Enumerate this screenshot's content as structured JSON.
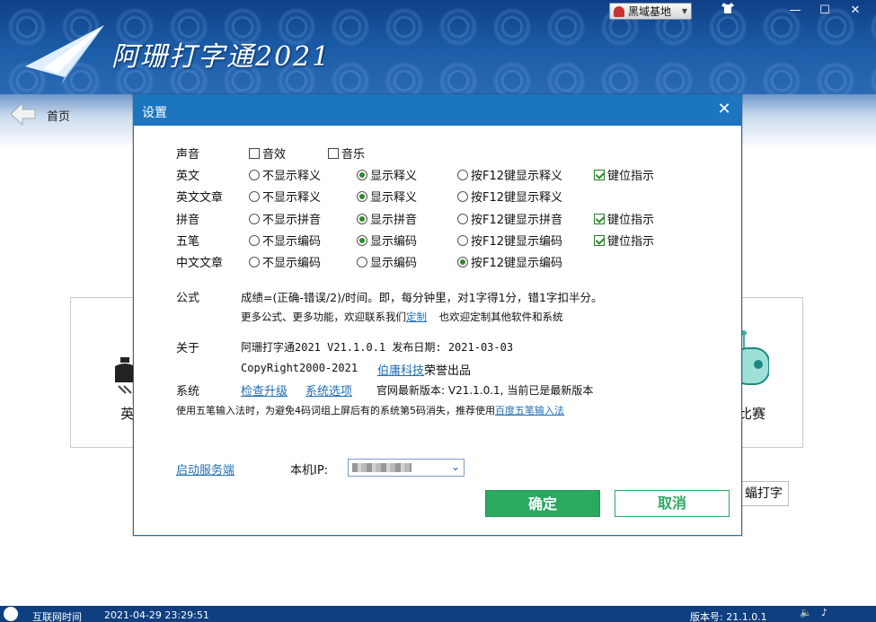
{
  "app": {
    "title": "阿珊打字通2021",
    "user_menu": "黑域基地",
    "home": "首页"
  },
  "background": {
    "tile_left_label": "英",
    "tile_right_label": "比赛",
    "type_button": "蝠打字"
  },
  "statusbar": {
    "net_time_label": "互联网时间",
    "net_time_value": "2021-04-29 23:29:51",
    "version_label": "版本号: 21.1.0.1"
  },
  "dialog": {
    "title": "设置",
    "close": "✕",
    "sound": {
      "label": "声音",
      "options": [
        {
          "label": "音效",
          "checked": false
        },
        {
          "label": "音乐",
          "checked": false
        }
      ]
    },
    "english": {
      "label": "英文",
      "options": [
        {
          "label": "不显示释义",
          "checked": false
        },
        {
          "label": "显示释义",
          "checked": true
        },
        {
          "label": "按F12键显示释义",
          "checked": false
        }
      ],
      "keyhint": {
        "label": "键位指示",
        "checked": true
      }
    },
    "english_article": {
      "label": "英文文章",
      "options": [
        {
          "label": "不显示释义",
          "checked": false
        },
        {
          "label": "显示释义",
          "checked": true
        },
        {
          "label": "按F12键显示释义",
          "checked": false
        }
      ]
    },
    "pinyin": {
      "label": "拼音",
      "options": [
        {
          "label": "不显示拼音",
          "checked": false
        },
        {
          "label": "显示拼音",
          "checked": true
        },
        {
          "label": "按F12键显示拼音",
          "checked": false
        }
      ],
      "keyhint": {
        "label": "键位指示",
        "checked": true
      }
    },
    "wubi": {
      "label": "五笔",
      "options": [
        {
          "label": "不显示编码",
          "checked": false
        },
        {
          "label": "显示编码",
          "checked": true
        },
        {
          "label": "按F12键显示编码",
          "checked": false
        }
      ],
      "keyhint": {
        "label": "键位指示",
        "checked": true
      }
    },
    "chinese_article": {
      "label": "中文文章",
      "options": [
        {
          "label": "不显示编码",
          "checked": false
        },
        {
          "label": "显示编码",
          "checked": false
        },
        {
          "label": "按F12键显示编码",
          "checked": true
        }
      ]
    },
    "formula": {
      "label": "公式",
      "text": "成绩=(正确-错误/2)/时间。即，每分钟里，对1字得1分，错1字扣半分。",
      "more_prefix": "更多公式、更多功能，欢迎联系我们",
      "customize_link": "定制",
      "more_suffix": "也欢迎定制其他软件和系统"
    },
    "about": {
      "label": "关于",
      "version_line": "阿珊打字通2021 V21.1.0.1 发布日期: 2021-03-03",
      "copyright": "CopyRight2000-2021",
      "company_link": "伯庸科技",
      "company_suffix": "荣誉出品"
    },
    "system": {
      "label": "系统",
      "check_update": "检查升级",
      "system_options": "系统选项",
      "latest_version": "官网最新版本: V21.1.0.1, 当前已是最新版本",
      "tip_prefix": "使用五笔输入法时，为避免4码词组上屏后有的系统第5码消失，推荐使用",
      "tip_link": "百度五笔输入法"
    },
    "server_link": "启动服务端",
    "ip_label": "本机IP:",
    "ok": "确定",
    "cancel": "取消"
  }
}
